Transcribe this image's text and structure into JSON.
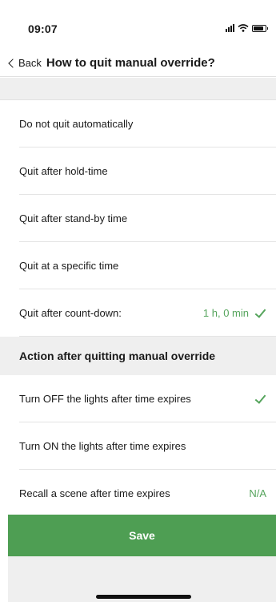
{
  "status": {
    "time": "09:07"
  },
  "nav": {
    "back_label": "Back",
    "title": "How to quit manual override?"
  },
  "quit_options": [
    {
      "label": "Do not quit automatically",
      "value": "",
      "checked": false
    },
    {
      "label": "Quit after hold-time",
      "value": "",
      "checked": false
    },
    {
      "label": "Quit after stand-by time",
      "value": "",
      "checked": false
    },
    {
      "label": "Quit at a specific time",
      "value": "",
      "checked": false
    },
    {
      "label": "Quit after count-down:",
      "value": "1 h, 0 min",
      "checked": true
    }
  ],
  "action_section": {
    "title": "Action after quitting manual override"
  },
  "action_options": [
    {
      "label": "Turn OFF the lights after time expires",
      "value": "",
      "checked": true
    },
    {
      "label": "Turn ON the lights after time expires",
      "value": "",
      "checked": false
    },
    {
      "label": "Recall a scene after time expires",
      "value": "N/A",
      "checked": false
    }
  ],
  "save_label": "Save",
  "colors": {
    "accent": "#4e9e53",
    "check": "#55a45c",
    "section_bg": "#efefef"
  }
}
